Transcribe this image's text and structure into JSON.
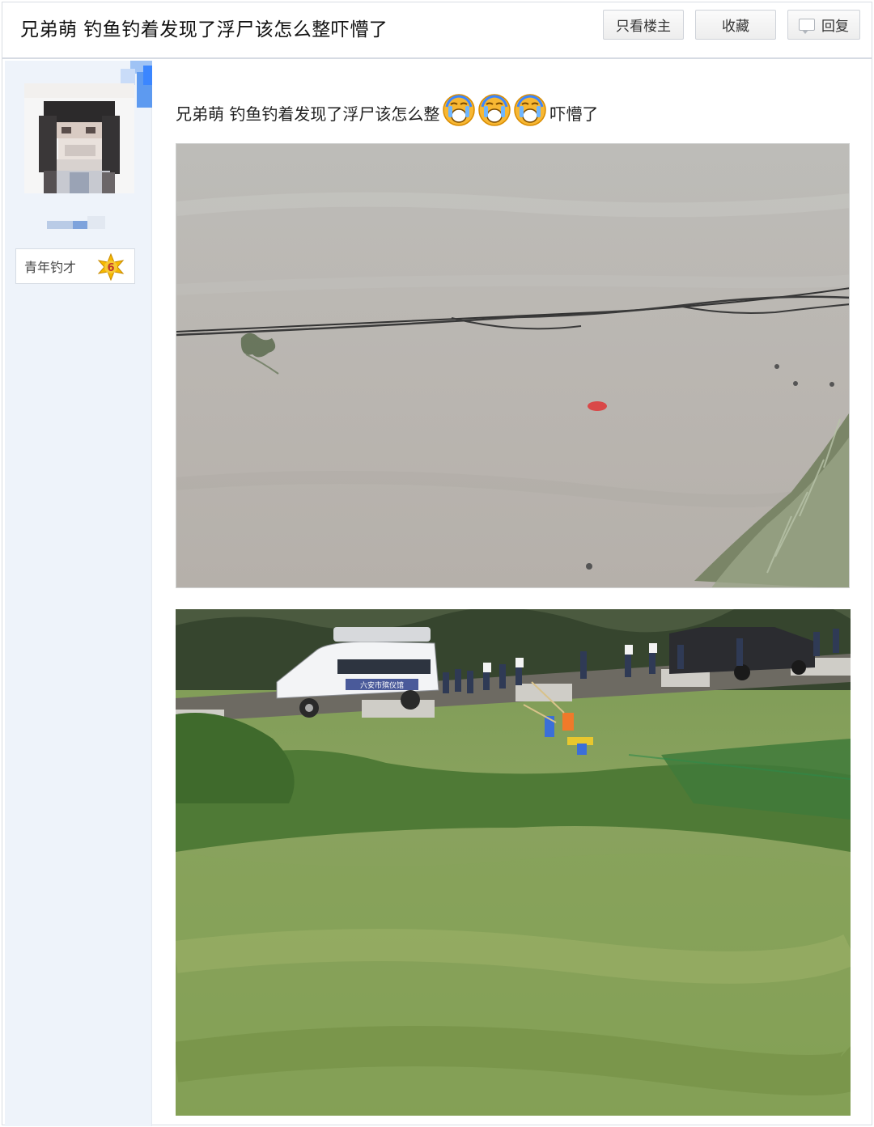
{
  "header": {
    "title": "兄弟萌 钓鱼钓着发现了浮尸该怎么整吓懵了",
    "buttons": {
      "only_op": "只看楼主",
      "favorite": "收藏",
      "reply": "回复"
    }
  },
  "sidebar": {
    "badge_label": "青年钓才",
    "level": "6"
  },
  "post": {
    "text_before": "兄弟萌 钓鱼钓着发现了浮尸该怎么整",
    "emoji_count": 3,
    "emoji_icon": "crying-face-icon",
    "text_after": "吓懵了"
  },
  "photos": {
    "river_van_text": "六安市殡仪馆"
  },
  "colors": {
    "sidebar_bg": "#eef3fa",
    "level_badge": "#f5b800",
    "accent": "#3b86ff"
  }
}
